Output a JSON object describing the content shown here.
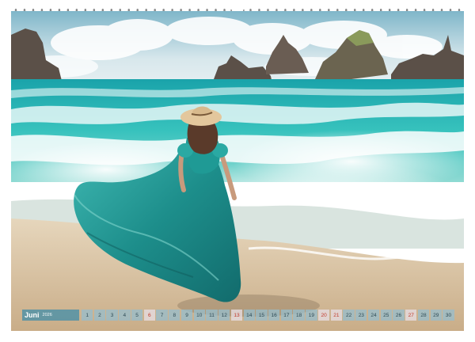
{
  "calendar": {
    "month": "Juni",
    "year": "2026",
    "days": [
      {
        "n": "1",
        "sun": false
      },
      {
        "n": "2",
        "sun": false
      },
      {
        "n": "3",
        "sun": false
      },
      {
        "n": "4",
        "sun": false
      },
      {
        "n": "5",
        "sun": false
      },
      {
        "n": "6",
        "sun": true
      },
      {
        "n": "7",
        "sun": false
      },
      {
        "n": "8",
        "sun": false
      },
      {
        "n": "9",
        "sun": false
      },
      {
        "n": "10",
        "sun": false
      },
      {
        "n": "11",
        "sun": false
      },
      {
        "n": "12",
        "sun": false
      },
      {
        "n": "13",
        "sun": true
      },
      {
        "n": "14",
        "sun": false
      },
      {
        "n": "15",
        "sun": false
      },
      {
        "n": "16",
        "sun": false
      },
      {
        "n": "17",
        "sun": false
      },
      {
        "n": "18",
        "sun": false
      },
      {
        "n": "19",
        "sun": false
      },
      {
        "n": "20",
        "sun": true
      },
      {
        "n": "21",
        "sun": true
      },
      {
        "n": "22",
        "sun": false
      },
      {
        "n": "23",
        "sun": false
      },
      {
        "n": "24",
        "sun": false
      },
      {
        "n": "25",
        "sun": false
      },
      {
        "n": "26",
        "sun": false
      },
      {
        "n": "27",
        "sun": true
      },
      {
        "n": "28",
        "sun": false
      },
      {
        "n": "29",
        "sun": false
      },
      {
        "n": "30",
        "sun": false
      }
    ]
  },
  "colors": {
    "sea": "#2fb3b0",
    "dress": "#1f8f8c",
    "sand": "#dcc7a8",
    "sky": "#cfe3ea",
    "sunday": "#c0392b"
  }
}
